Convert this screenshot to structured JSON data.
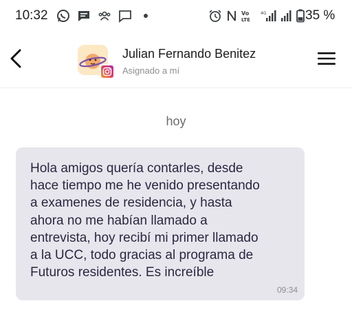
{
  "status_bar": {
    "time": "10:32",
    "battery_text": "35 %",
    "icons_left": [
      "whatsapp-icon",
      "chat-icon",
      "groups-icon",
      "message-icon",
      "dot-icon"
    ],
    "icons_right": [
      "alarm-icon",
      "nfc-icon",
      "volte-icon",
      "signal-icon",
      "signal-icon",
      "battery-icon"
    ]
  },
  "header": {
    "back_icon": "chevron-left-icon",
    "contact_name": "Julian Fernando Benitez",
    "subtitle": "Asignado a mí",
    "channel_icon": "instagram-icon",
    "menu_icon": "hamburger-menu-icon"
  },
  "conversation": {
    "date_separator": "hoy",
    "messages": [
      {
        "text": "Hola amigos quería contarles, desde\nhace tiempo me he venido presentando\na examenes de residencia, y hasta\nahora no me habían llamado a\nentrevista, hoy recibí mi primer llamado\na la UCC, todo gracias al programa de\nFuturos residentes. Es increíble",
        "time": "09:34"
      }
    ]
  },
  "colors": {
    "bubble_background": "#e6e6ec",
    "message_text": "#2b2742",
    "avatar_background": "#fde8c4"
  }
}
